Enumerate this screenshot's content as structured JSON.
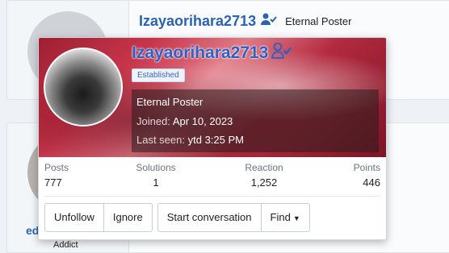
{
  "background": {
    "username": "Izayaorihara2713",
    "user_title": "Eternal Poster",
    "partial_username": "ed",
    "partial_title": "Addict"
  },
  "popup": {
    "username": "Izayaorihara2713",
    "badge": "Established",
    "title": "Eternal Poster",
    "joined_label": "Joined:",
    "joined_value": "Apr 10, 2023",
    "lastseen_label": "Last seen:",
    "lastseen_value": "ytd 3:25 PM",
    "stats": [
      {
        "label": "Posts",
        "value": "777"
      },
      {
        "label": "Solutions",
        "value": "1"
      },
      {
        "label": "Reaction",
        "value": "1,252"
      },
      {
        "label": "Points",
        "value": "446"
      }
    ],
    "buttons": {
      "unfollow": "Unfollow",
      "ignore": "Ignore",
      "start_conversation": "Start conversation",
      "find": "Find"
    }
  },
  "colors": {
    "link": "#2c62b0",
    "banner": "#c8354a"
  },
  "icons": [
    "user-check-icon",
    "caret-down-icon"
  ]
}
